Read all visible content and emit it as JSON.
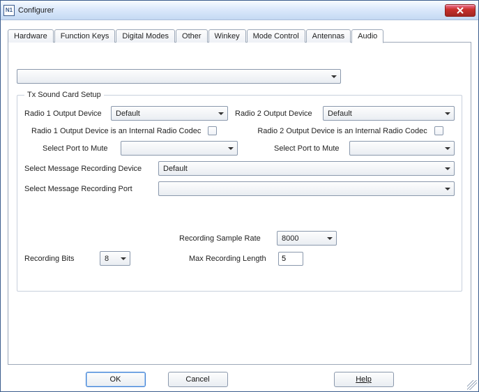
{
  "window": {
    "title": "Configurer",
    "icon_text": "N1"
  },
  "tabs": [
    {
      "label": "Hardware"
    },
    {
      "label": "Function Keys"
    },
    {
      "label": "Digital Modes"
    },
    {
      "label": "Other"
    },
    {
      "label": "Winkey"
    },
    {
      "label": "Mode Control"
    },
    {
      "label": "Antennas"
    },
    {
      "label": "Audio"
    }
  ],
  "active_tab_index": 7,
  "top_combo": {
    "value": ""
  },
  "group": {
    "legend": "Tx Sound Card Setup",
    "radio1": {
      "label": "Radio 1 Output Device",
      "value": "Default",
      "codec_label": "Radio 1 Output Device is an Internal Radio Codec",
      "codec_checked": false,
      "mute_label": "Select Port to Mute",
      "mute_value": ""
    },
    "radio2": {
      "label": "Radio 2 Output Device",
      "value": "Default",
      "codec_label": "Radio 2 Output Device is an Internal Radio Codec",
      "codec_checked": false,
      "mute_label": "Select Port to Mute",
      "mute_value": ""
    },
    "msg_device": {
      "label": "Select Message Recording Device",
      "value": "Default"
    },
    "msg_port": {
      "label": "Select Message Recording Port",
      "value": ""
    },
    "sample_rate": {
      "label": "Recording Sample Rate",
      "value": "8000"
    },
    "max_len": {
      "label": "Max Recording Length",
      "value": "5"
    },
    "rec_bits": {
      "label": "Recording Bits",
      "value": "8"
    }
  },
  "buttons": {
    "ok": "OK",
    "cancel": "Cancel",
    "help": "Help"
  }
}
